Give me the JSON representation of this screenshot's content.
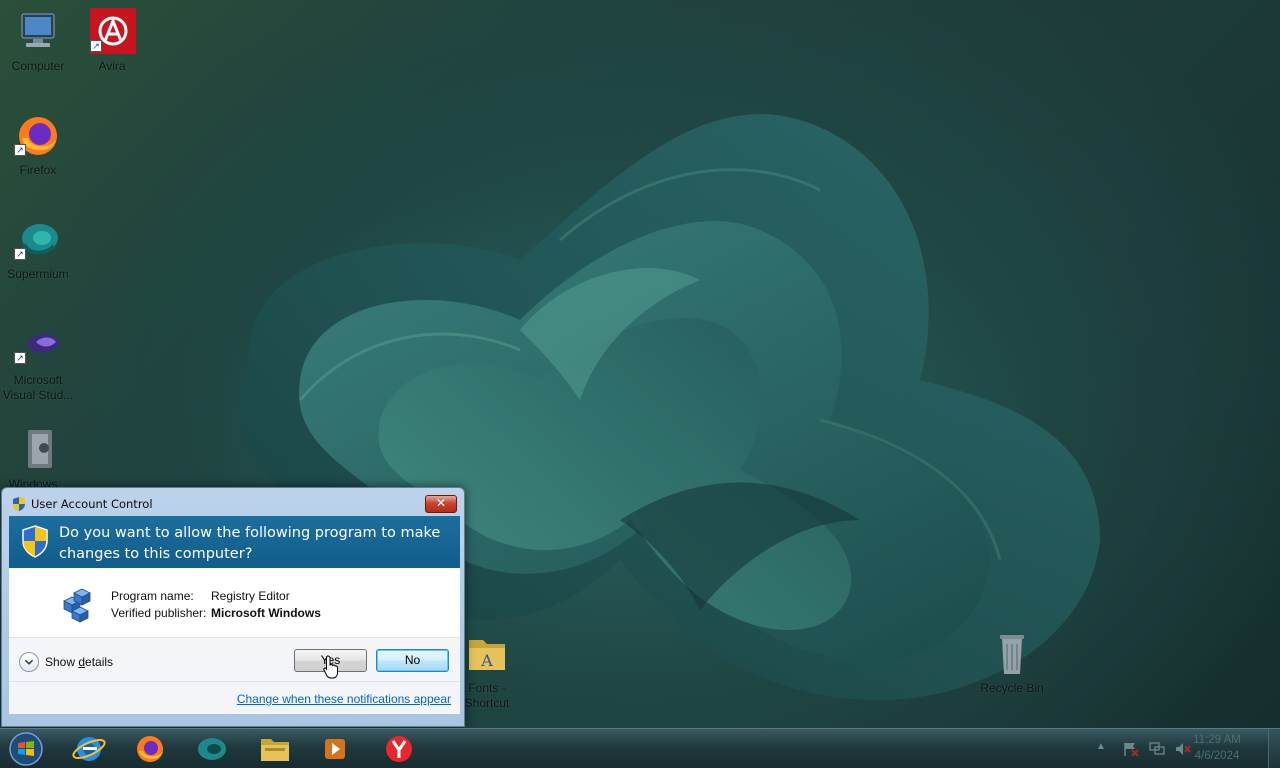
{
  "desktop": {
    "icons": [
      {
        "label": "Computer"
      },
      {
        "label": "Avira"
      },
      {
        "label": "Firefox"
      },
      {
        "label": "Supermium"
      },
      {
        "label": "Microsoft Visual Stud..."
      },
      {
        "label": "Windows..."
      },
      {
        "label": "Fonts - Shortcut"
      },
      {
        "label": "Recycle Bin"
      }
    ]
  },
  "uac": {
    "title": "User Account Control",
    "close_label": "✕",
    "question": "Do you want to allow the following program to make changes to this computer?",
    "program_name_label": "Program name:",
    "program_name_value": "Registry Editor",
    "publisher_label": "Verified publisher:",
    "publisher_value": "Microsoft Windows",
    "show_details_pre": "Show ",
    "show_details_acc": "d",
    "show_details_post": "etails",
    "yes_acc": "Y",
    "yes_rest": "es",
    "no_acc": "N",
    "no_rest": "o",
    "change_link": "Change when these notifications appear"
  },
  "taskbar": {
    "pinned": [
      "start-orb",
      "internet-explorer-icon",
      "firefox-icon",
      "supermium-icon",
      "file-explorer-icon",
      "media-player-icon",
      "yandex-icon"
    ],
    "clock_time": "11:29 AM",
    "clock_date": "4/6/2024"
  },
  "colors": {
    "uac_header": "#115d8b",
    "link": "#0066cc",
    "close_button": "#c9452f"
  }
}
